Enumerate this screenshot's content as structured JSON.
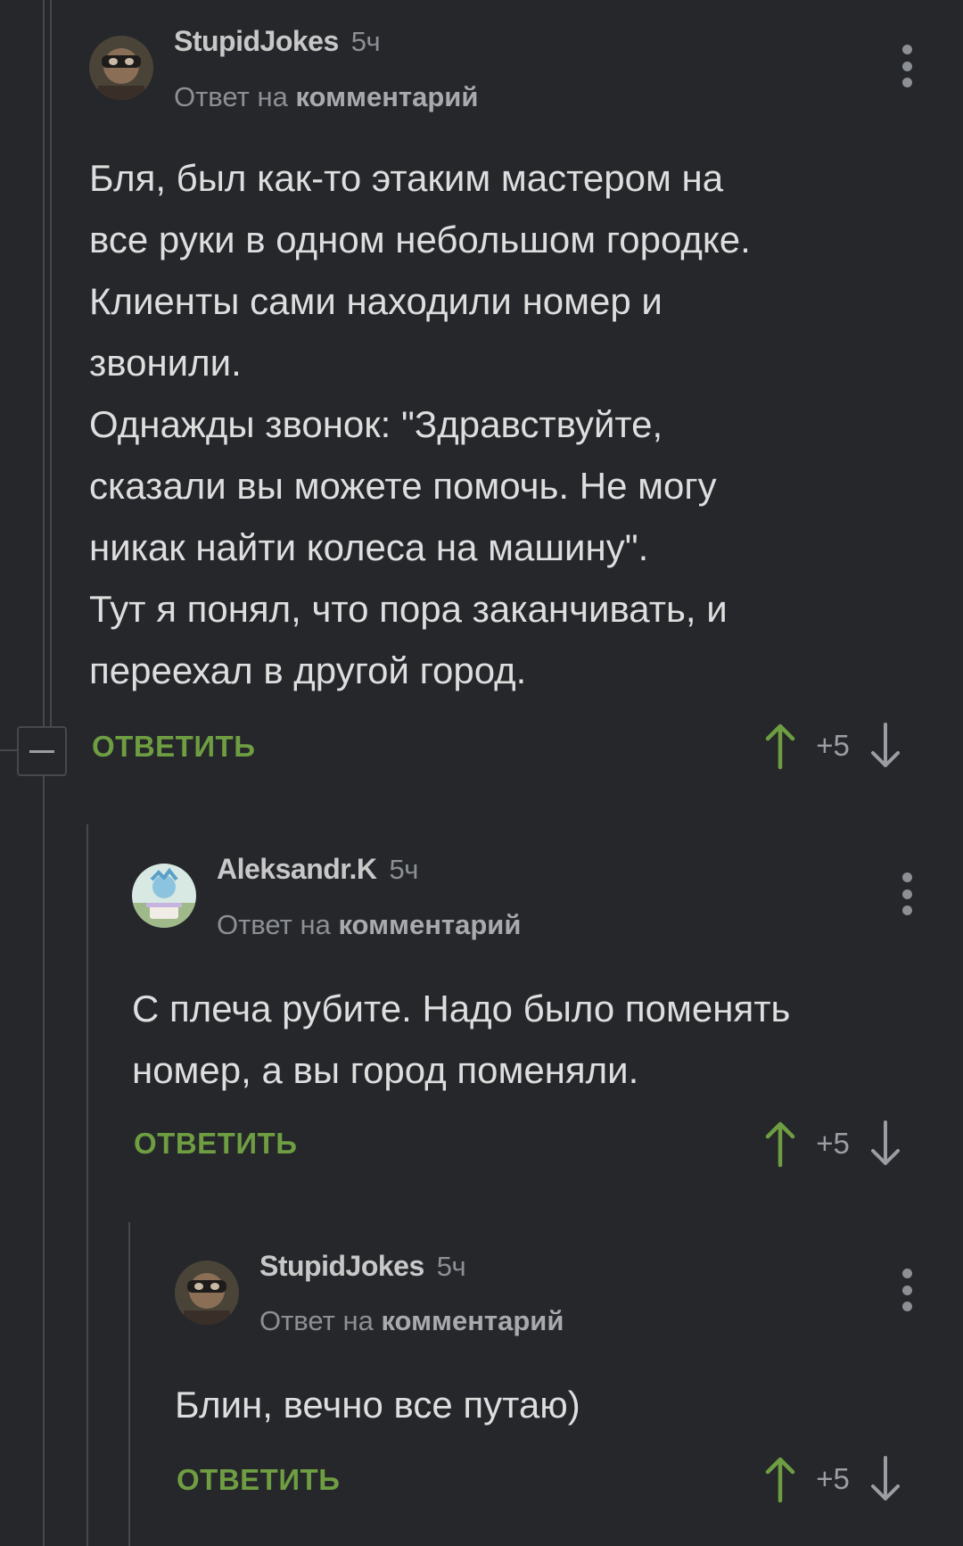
{
  "thread": {
    "comments": [
      {
        "author": "StupidJokes",
        "time": "5ч",
        "reply_prefix": "Ответ на",
        "reply_target": "комментарий",
        "text": "Бля, был как-то этаким мастером на\nвсе руки в одном небольшом городке.\nКлиенты сами находили номер и\nзвонили.\nОднажды звонок: \"Здравствуйте,\nсказали вы можете помочь. Не могу\nникак найти колеса на машину\".\nТут я понял, что пора заканчивать, и\nпереехал в другой город.",
        "reply_label": "ОТВЕТИТЬ",
        "rating": "+5",
        "avatar": "avatar-masked-man"
      },
      {
        "author": "Aleksandr.K",
        "time": "5ч",
        "reply_prefix": "Ответ на",
        "reply_target": "комментарий",
        "text": "С плеча рубите. Надо было поменять\nномер, а вы город поменяли.",
        "reply_label": "ОТВЕТИТЬ",
        "rating": "+5",
        "avatar": "avatar-cartoon"
      },
      {
        "author": "StupidJokes",
        "time": "5ч",
        "reply_prefix": "Ответ на",
        "reply_target": "комментарий",
        "text": "Блин, вечно все путаю)",
        "reply_label": "ОТВЕТИТЬ",
        "rating": "+5",
        "avatar": "avatar-masked-man"
      }
    ]
  },
  "colors": {
    "background": "#25272b",
    "accent_green": "#6e9e41",
    "thread_line": "#45484d",
    "muted_text": "#8c8f94"
  },
  "icons": [
    "kebab-menu-icon",
    "upvote-arrow-icon",
    "downvote-arrow-icon",
    "collapse-minus-icon"
  ]
}
